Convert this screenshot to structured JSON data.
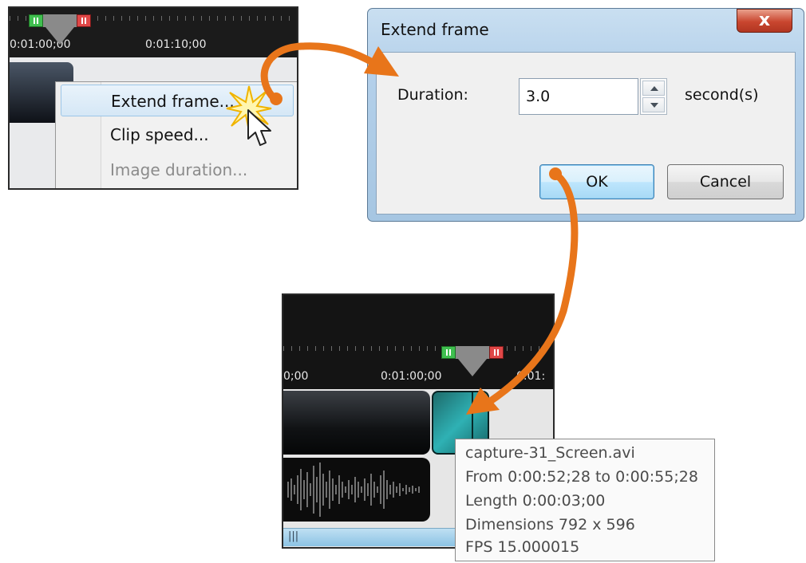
{
  "panel1": {
    "timecodes": [
      "0:01:00;00",
      "0:01:10;00"
    ],
    "context_menu": {
      "items": [
        {
          "label": "Extend frame...",
          "state": "highlighted"
        },
        {
          "label": "Clip speed...",
          "state": "enabled"
        },
        {
          "label": "Image duration...",
          "state": "disabled"
        }
      ]
    }
  },
  "dialog": {
    "title": "Extend frame",
    "close_glyph": "x",
    "duration_label": "Duration:",
    "duration_value": "3.0",
    "unit_label": "second(s)",
    "ok_label": "OK",
    "cancel_label": "Cancel"
  },
  "panel3": {
    "timecodes": [
      "0;00",
      "0:01:00;00",
      "0:01:"
    ],
    "tooltip": {
      "lines": [
        "capture-31_Screen.avi",
        "From 0:00:52;28 to 0:00:55;28",
        "Length 0:00:03;00",
        "Dimensions 792 x 596",
        "FPS 15.000015"
      ]
    }
  },
  "colors": {
    "arrow": "#e8751a",
    "teal_clip": "#2fb1b4",
    "marker_green": "#3fbf4f",
    "marker_red": "#e04747"
  },
  "icons": [
    "in-marker-icon",
    "out-marker-icon",
    "playhead-icon",
    "mouse-cursor-icon",
    "click-burst-icon",
    "close-icon",
    "spin-up-icon",
    "spin-down-icon",
    "flow-arrow-icon"
  ]
}
